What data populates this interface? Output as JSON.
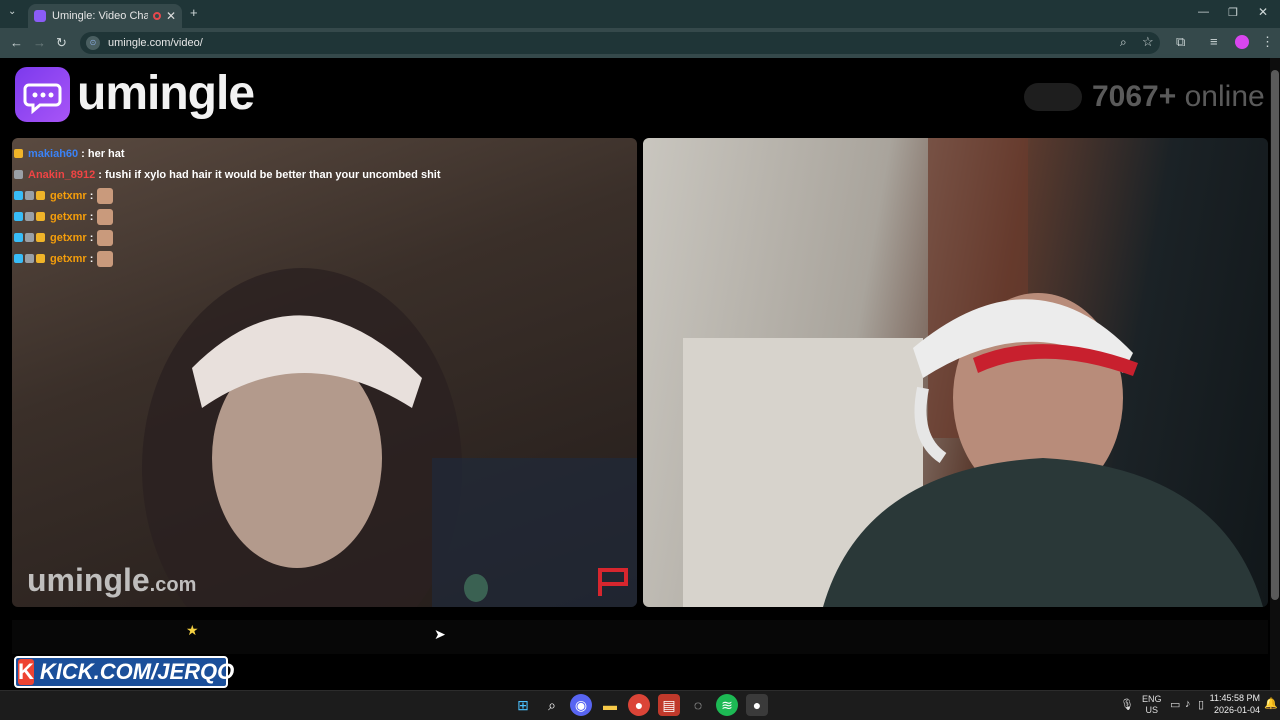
{
  "browser": {
    "tab_title": "Umingle: Video Chat with S",
    "tab_close": "✕",
    "new_tab": "+",
    "url": "umingle.com/video/",
    "colors": {
      "frame": "#1f3537",
      "toolbar": "#35494b"
    }
  },
  "header": {
    "logo_text": "umingle",
    "online_count": "7067",
    "online_plus": "+",
    "online_word": "online"
  },
  "chat": [
    {
      "badges": [
        "gold"
      ],
      "user": "makiah60",
      "user_color": "#3b82f6",
      "text": ": her hat",
      "emote": false
    },
    {
      "badges": [
        "gray"
      ],
      "user": "Anakin_8912",
      "user_color": "#ef4444",
      "text": ": fushi if xylo had hair it would be better than your uncombed shit",
      "emote": false
    },
    {
      "badges": [
        "cyan",
        "gray",
        "gold"
      ],
      "user": "getxmr",
      "user_color": "#f59e0b",
      "text": " :",
      "emote": true
    },
    {
      "badges": [
        "cyan",
        "gray",
        "gold"
      ],
      "user": "getxmr",
      "user_color": "#f59e0b",
      "text": " :",
      "emote": true
    },
    {
      "badges": [
        "cyan",
        "gray",
        "gold"
      ],
      "user": "getxmr",
      "user_color": "#f59e0b",
      "text": " :",
      "emote": true
    },
    {
      "badges": [
        "cyan",
        "gray",
        "gold"
      ],
      "user": "getxmr",
      "user_color": "#f59e0b",
      "text": " :",
      "emote": true
    }
  ],
  "watermark": {
    "name": "umingle",
    "domain": ".com"
  },
  "overlay": {
    "kick_text": "KICK.COM/JERQO",
    "kick_letter": "K"
  },
  "taskbar": {
    "lang_top": "ENG",
    "lang_bottom": "US",
    "time": "11:45:58 PM",
    "date": "2026-01-04"
  },
  "accent": "#8b5cf6"
}
